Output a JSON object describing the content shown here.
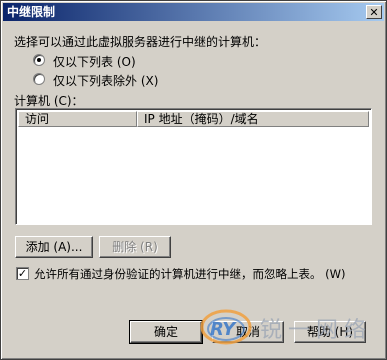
{
  "window": {
    "title": "中继限制",
    "close_glyph": "✕"
  },
  "prompt_label": "选择可以通过此虚拟服务器进行中继的计算机：",
  "radio_options": [
    {
      "label": "仅以下列表 (O)",
      "checked": true
    },
    {
      "label": "仅以下列表除外 (X)",
      "checked": false
    }
  ],
  "computers_label": "计算机 (C)：",
  "table": {
    "columns": [
      "访问",
      "IP 地址（掩码）/域名"
    ],
    "rows": []
  },
  "buttons": {
    "add": "添加 (A)...",
    "remove": "删除 (R)",
    "ok": "确定",
    "cancel": "取消",
    "help": "帮助 (H)"
  },
  "checkbox": {
    "label": "允许所有通过身份验证的计算机进行中继，而忽略上表。 (W)",
    "checked": true,
    "check_glyph": "✓"
  },
  "watermark": {
    "logo": "RY",
    "text": "锐一网络"
  }
}
